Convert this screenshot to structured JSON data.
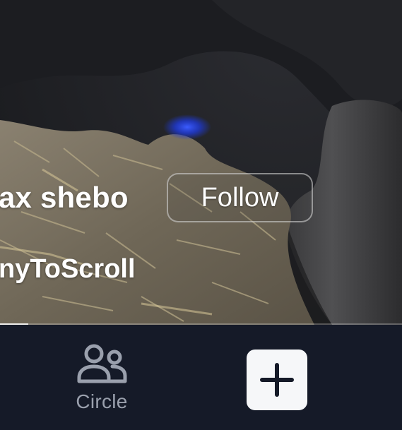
{
  "video": {
    "username": "ax shebo",
    "follow_label": "Follow",
    "caption": "nyToScroll",
    "progress": 0.07
  },
  "bottom_nav": {
    "items": [
      {
        "label": "Circle",
        "icon": "people-icon"
      }
    ],
    "create_icon": "plus-icon"
  },
  "colors": {
    "nav_background": "#151a28",
    "nav_label": "#9aa0ad",
    "create_button_bg": "#f6f7f9"
  }
}
